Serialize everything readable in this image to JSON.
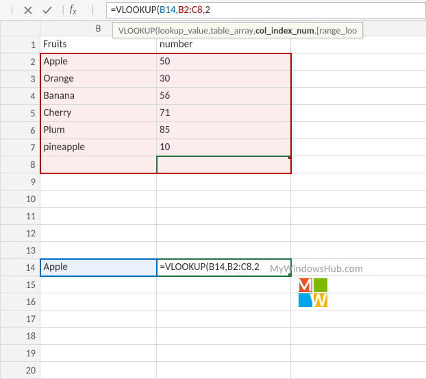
{
  "formula_bar": {
    "formula_prefix": "=VLOOKUP(",
    "arg1": "B14",
    "sep1": ",",
    "arg2": "B2:C8",
    "sep2": ",",
    "arg3": "2"
  },
  "func_tip": {
    "fn": "VLOOKUP(",
    "p1": "lookup_value",
    "s1": ", ",
    "p2": "table_array",
    "s2": ", ",
    "p3_bold": "col_index_num",
    "s3": ", ",
    "p4": "[range_loo"
  },
  "columns": {
    "b_label": "B"
  },
  "rows": {
    "r1": {
      "num": "1",
      "b": "Fruits",
      "c": "number"
    },
    "r2": {
      "num": "2",
      "b": "Apple",
      "c": "50"
    },
    "r3": {
      "num": "3",
      "b": "Orange",
      "c": "30"
    },
    "r4": {
      "num": "4",
      "b": "Banana",
      "c": "56"
    },
    "r5": {
      "num": "5",
      "b": "Cherry",
      "c": "71"
    },
    "r6": {
      "num": "6",
      "b": "Plum",
      "c": "85"
    },
    "r7": {
      "num": "7",
      "b": "pineapple",
      "c": "10"
    },
    "r8": {
      "num": "8"
    },
    "r9": {
      "num": "9"
    },
    "r10": {
      "num": "10"
    },
    "r11": {
      "num": "11"
    },
    "r12": {
      "num": "12"
    },
    "r13": {
      "num": "13"
    },
    "r14": {
      "num": "14",
      "b": "Apple",
      "c": "=VLOOKUP(B14,B2:C8,2"
    },
    "r15": {
      "num": "15"
    },
    "r16": {
      "num": "16"
    },
    "r17": {
      "num": "17"
    },
    "r18": {
      "num": "18"
    },
    "r19": {
      "num": "19"
    },
    "r20": {
      "num": "20"
    }
  },
  "watermark": {
    "text": "MyWindowsHub.com"
  }
}
